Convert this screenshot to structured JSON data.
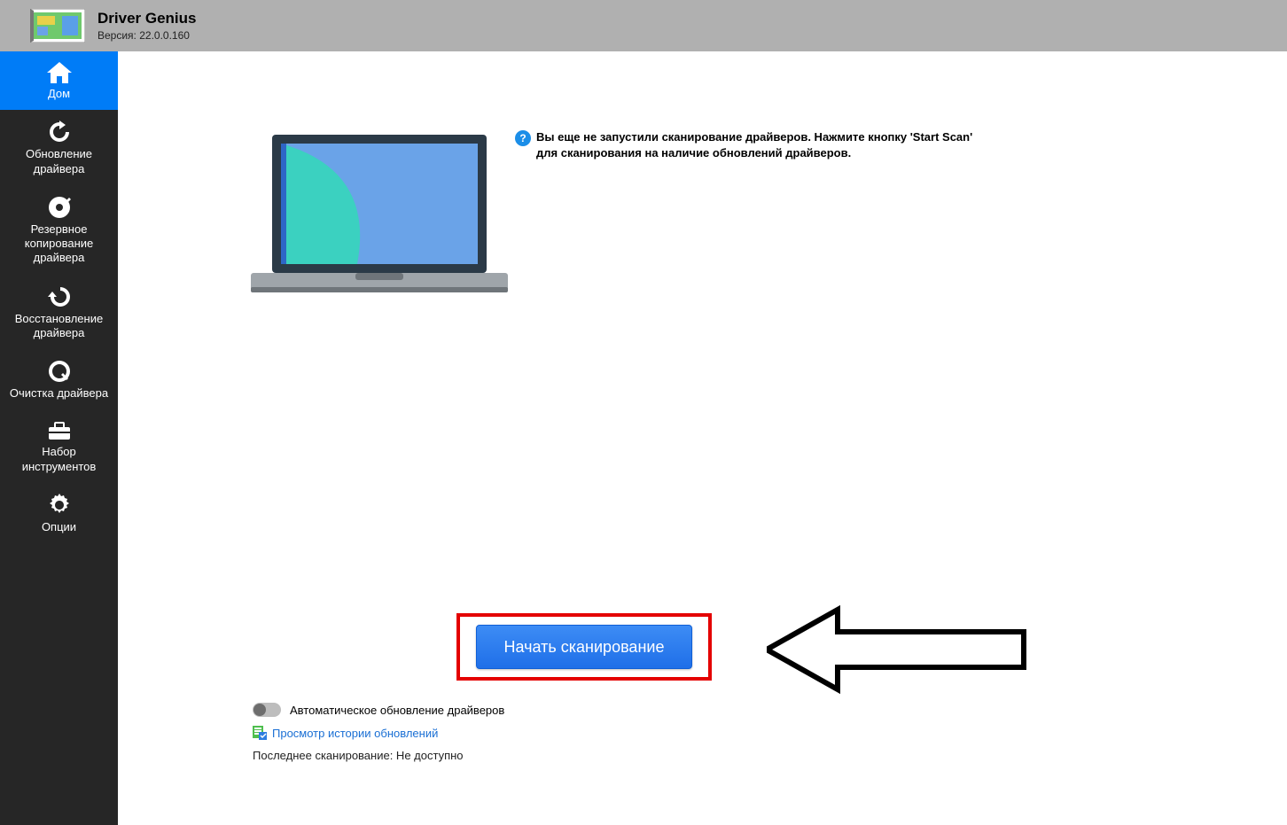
{
  "header": {
    "title": "Driver Genius",
    "version": "Версия: 22.0.0.160"
  },
  "sidebar": {
    "items": [
      {
        "label": "Дом"
      },
      {
        "label": "Обновление\nдрайвера"
      },
      {
        "label": "Резервное\nкопирование\nдрайвера"
      },
      {
        "label": "Восстановление\nдрайвера"
      },
      {
        "label": "Очистка драйвера"
      },
      {
        "label": "Набор\nинструментов"
      },
      {
        "label": "Опции"
      }
    ]
  },
  "main": {
    "info_text": "Вы еще не запустили сканирование драйверов. Нажмите кнопку 'Start Scan' для сканирования на наличие обновлений драйверов.",
    "scan_button_label": "Начать  сканирование",
    "auto_update_label": "Автоматическое обновление драйверов",
    "history_link_label": "Просмотр истории обновлений",
    "last_scan_label": "Последнее сканирование: Не доступно"
  }
}
